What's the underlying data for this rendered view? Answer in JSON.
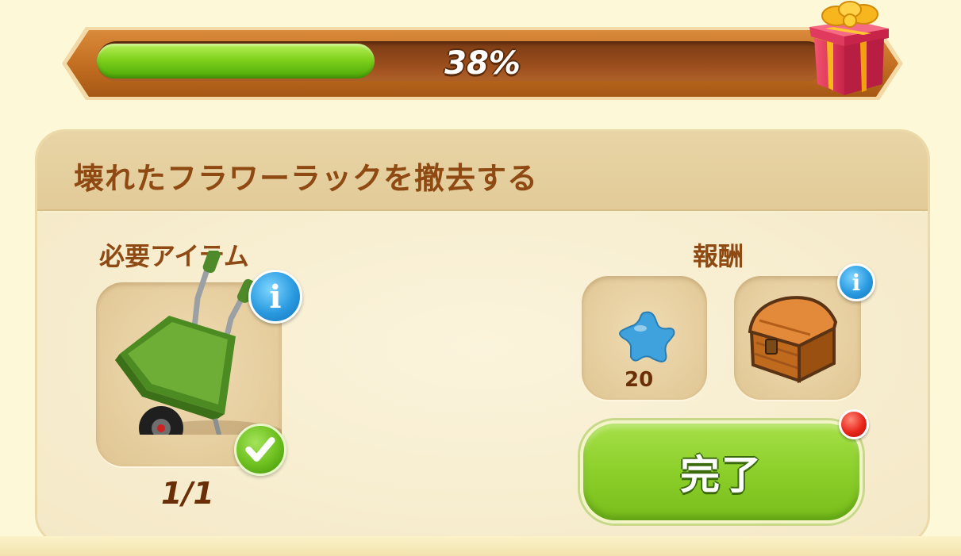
{
  "progress": {
    "percent_label": "38%",
    "fill_fraction": 0.38,
    "reward_icon": "gift-box-icon"
  },
  "task": {
    "title": "壊れたフラワーラックを撤去する"
  },
  "required": {
    "label": "必要アイテム",
    "item_icon": "wheelbarrow-icon",
    "quantity": "1/1",
    "info_icon": "info-icon",
    "status_icon": "checkmark-icon"
  },
  "rewards": {
    "label": "報酬",
    "items": [
      {
        "icon": "blue-star-icon",
        "amount": "20"
      },
      {
        "icon": "treasure-chest-icon",
        "info_icon": "info-icon"
      }
    ]
  },
  "actions": {
    "complete_label": "完了",
    "has_notification": true
  },
  "colors": {
    "accent_green": "#8ccf2a",
    "title_brown": "#8e4a12",
    "info_blue": "#2a9ae0",
    "notify_red": "#e8261a"
  }
}
